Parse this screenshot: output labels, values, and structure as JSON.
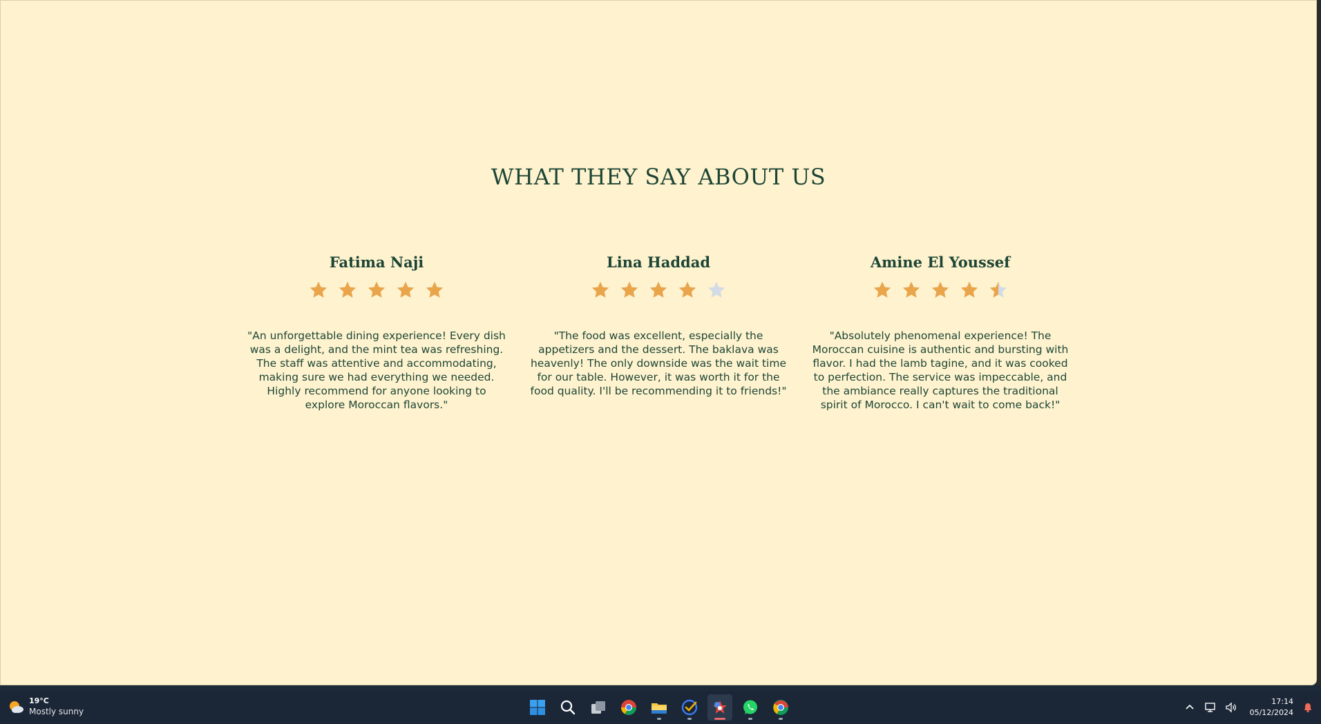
{
  "section": {
    "title": "WHAT THEY SAY ABOUT US"
  },
  "testimonials": [
    {
      "name": "Fatima Naji",
      "rating": 5,
      "text": "\"An unforgettable dining experience! Every dish was a delight, and the mint tea was refreshing. The staff was attentive and accommodating, making sure we had everything we needed. Highly recommend for anyone looking to explore Moroccan flavors.\""
    },
    {
      "name": "Lina Haddad",
      "rating": 4,
      "text": "\"The food was excellent, especially the appetizers and the dessert. The baklava was heavenly! The only downside was the wait time for our table. However, it was worth it for the food quality. I'll be recommending it to friends!\""
    },
    {
      "name": "Amine El Youssef",
      "rating": 4.5,
      "text": "\"Absolutely phenomenal experience! The Moroccan cuisine is authentic and bursting with flavor. I had the lamb tagine, and it was cooked to perfection. The service was impeccable, and the ambiance really captures the traditional spirit of Morocco. I can't wait to come back!\""
    }
  ],
  "colors": {
    "page_bg": "#fff3cf",
    "text_green": "#1d4535",
    "star_filled": "#eaa54b",
    "star_empty": "#d3dbe6",
    "taskbar_bg": "#1b2637"
  },
  "taskbar": {
    "weather": {
      "temp": "19°C",
      "desc": "Mostly sunny",
      "icon": "partly-sunny-icon"
    },
    "apps": [
      {
        "icon": "windows-start-icon",
        "active": false,
        "running": false
      },
      {
        "icon": "search-icon",
        "active": false,
        "running": false
      },
      {
        "icon": "task-view-icon",
        "active": false,
        "running": false
      },
      {
        "icon": "chrome-icon",
        "active": false,
        "running": false
      },
      {
        "icon": "file-explorer-icon",
        "active": false,
        "running": true
      },
      {
        "icon": "todo-check-icon",
        "active": false,
        "running": true
      },
      {
        "icon": "paint-app-icon",
        "active": true,
        "running": true
      },
      {
        "icon": "whatsapp-icon",
        "active": false,
        "running": true
      },
      {
        "icon": "chrome-alt-icon",
        "active": false,
        "running": true
      }
    ],
    "tray": {
      "time": "17:14",
      "date": "05/12/2024"
    }
  }
}
